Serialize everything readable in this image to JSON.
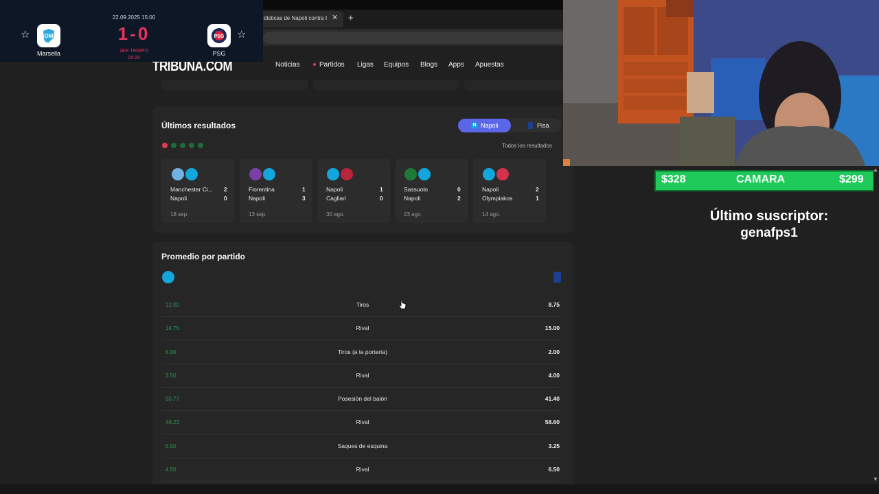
{
  "browser": {
    "tab_title": "dísticas de Napoli contra P",
    "tab_close": "✕",
    "tab_new": "+"
  },
  "site": {
    "logo": "TRIBUNA.COM",
    "nav": [
      "Noticias",
      "Partidos",
      "Ligas",
      "Equipos",
      "Blogs",
      "Apps",
      "Apuestas"
    ]
  },
  "scoreboard": {
    "date": "22.09.2025 15:00",
    "score": "1-0",
    "period": "1ER TIEMPO",
    "clock": "26:28",
    "home_team": "Marsella",
    "away_team": "PSG",
    "star_icon": "☆"
  },
  "last_results": {
    "title": "Últimos resultados",
    "toggle": [
      "Napoli",
      "Pisa"
    ],
    "all_results_link": "Todos los resultados",
    "form": [
      "loss",
      "win",
      "win",
      "win",
      "win"
    ],
    "matches": [
      {
        "team1": "Manchester Ci...",
        "score1": "2",
        "team2": "Napoli",
        "score2": "0",
        "date": "18 sep."
      },
      {
        "team1": "Fiorentina",
        "score1": "1",
        "team2": "Napoli",
        "score2": "3",
        "date": "13 sep."
      },
      {
        "team1": "Napoli",
        "score1": "1",
        "team2": "Cagliari",
        "score2": "0",
        "date": "30 ago."
      },
      {
        "team1": "Sassuolo",
        "score1": "0",
        "team2": "Napoli",
        "score2": "2",
        "date": "23 ago."
      },
      {
        "team1": "Napoli",
        "score1": "2",
        "team2": "Olympiakos",
        "score2": "1",
        "date": "14 ago."
      }
    ]
  },
  "averages": {
    "title": "Promedio por partido",
    "rows": [
      {
        "left": "12.00",
        "label": "Tiros",
        "right": "8.75"
      },
      {
        "left": "14.75",
        "label": "Rival",
        "right": "15.00"
      },
      {
        "left": "5.00",
        "label": "Tiros (a la portería)",
        "right": "2.00"
      },
      {
        "left": "3.50",
        "label": "Rival",
        "right": "4.00"
      },
      {
        "left": "50.77",
        "label": "Posesión del balón",
        "right": "41.40"
      },
      {
        "left": "49.23",
        "label": "Rival",
        "right": "58.60"
      },
      {
        "left": "5.50",
        "label": "Saques de esquina",
        "right": "3.25"
      },
      {
        "left": "4.50",
        "label": "Rival",
        "right": "6.50"
      }
    ]
  },
  "stream": {
    "goal_left": "$328",
    "goal_center": "CAMARA",
    "goal_right": "$299",
    "last_sub_title": "Último suscriptor:",
    "last_sub_name": "genafps1"
  },
  "colors": {
    "accent": "#5b67e8",
    "score_red": "#e9335c",
    "stat_green": "#2d9a57",
    "goal_green": "#1ecb5a",
    "napoli_blue": "#12a6dd"
  }
}
